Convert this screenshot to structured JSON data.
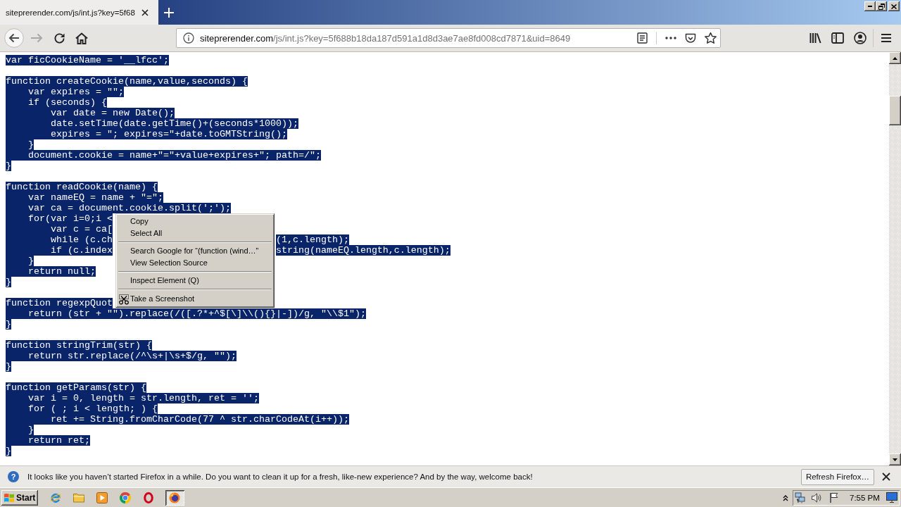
{
  "window": {
    "tabs": [
      {
        "title": "siteprerender.com/js/int.js?key=5f68",
        "selected": true
      }
    ]
  },
  "toolbar": {
    "back": {
      "disabled": false
    },
    "forward": {
      "disabled": true
    },
    "url_host": "siteprerender.com",
    "url_path": "/js/int.js?key=5f688b18da187d591a1d8d3ae7ae8fd008cd7871&uid=8649"
  },
  "page": {
    "text_selected": true,
    "blocks": [
      {
        "lines": [
          {
            "text": "var ficCookieName = '__lfcc';"
          }
        ]
      },
      {
        "lines": [
          {
            "text": "function createCookie(name,value,seconds) {"
          },
          {
            "text": "    var expires = \"\";"
          },
          {
            "text": "    if (seconds) {"
          },
          {
            "text": "        var date = new Date();"
          },
          {
            "text": "        date.setTime(date.getTime()+(seconds*1000));"
          },
          {
            "text": "        expires = \"; expires=\"+date.toGMTString();"
          },
          {
            "text": "    }"
          },
          {
            "text": "    document.cookie = name+\"=\"+value+expires+\"; path=/\";"
          },
          {
            "text": "}"
          }
        ]
      },
      {
        "lines": [
          {
            "text": "function readCookie(name) {"
          },
          {
            "text": "    var nameEQ = name + \"=\";"
          },
          {
            "text": "    var ca = document.cookie.split(';');"
          },
          {
            "text": "    for(var i=0;i <"
          },
          {
            "text": "        var c = ca["
          },
          {
            "text": "        while (c.ch",
            "tail": "(1,c.length);"
          },
          {
            "text": "        if (c.index",
            "tail": "string(nameEQ.length,c.length);"
          },
          {
            "text": "    }"
          },
          {
            "text": "    return null;"
          },
          {
            "text": "}"
          }
        ]
      },
      {
        "lines": [
          {
            "text": "function regexpQuot"
          },
          {
            "text": "    return (str + \"\").replace(/([.?*+^$[\\]\\\\(){}|-])/g, \"\\\\$1\");"
          },
          {
            "text": "}"
          }
        ]
      },
      {
        "lines": [
          {
            "text": "function stringTrim(str) {"
          },
          {
            "text": "    return str.replace(/^\\s+|\\s+$/g, \"\");"
          },
          {
            "text": "}"
          }
        ]
      },
      {
        "lines": [
          {
            "text": "function getParams(str) {"
          },
          {
            "text": "    var i = 0, length = str.length, ret = '';"
          },
          {
            "text": "    for ( ; i < length; ) {"
          },
          {
            "text": "        ret += String.fromCharCode(77 ^ str.charCodeAt(i++));"
          },
          {
            "text": "    }"
          },
          {
            "text": "    return ret;"
          },
          {
            "text": "}"
          }
        ]
      }
    ]
  },
  "context_menu": {
    "groups": [
      {
        "items": [
          {
            "label": "Copy"
          },
          {
            "label": "Select All"
          }
        ]
      },
      {
        "items": [
          {
            "label": "Search Google for “(function (wind…”"
          },
          {
            "label": "View Selection Source"
          }
        ]
      },
      {
        "items": [
          {
            "label": "Inspect Element (Q)"
          }
        ]
      },
      {
        "items": [
          {
            "label": "Take a Screenshot",
            "icon": true
          }
        ]
      }
    ]
  },
  "notification": {
    "icon": "?",
    "message": "It looks like you haven’t started Firefox in a while. Do you want to clean it up for a fresh, like-new experience? And by the way, welcome back!",
    "button": "Refresh Firefox…"
  },
  "taskbar": {
    "start": "Start",
    "window_button": {
      "selected": true
    },
    "clock": "7:55 PM"
  }
}
